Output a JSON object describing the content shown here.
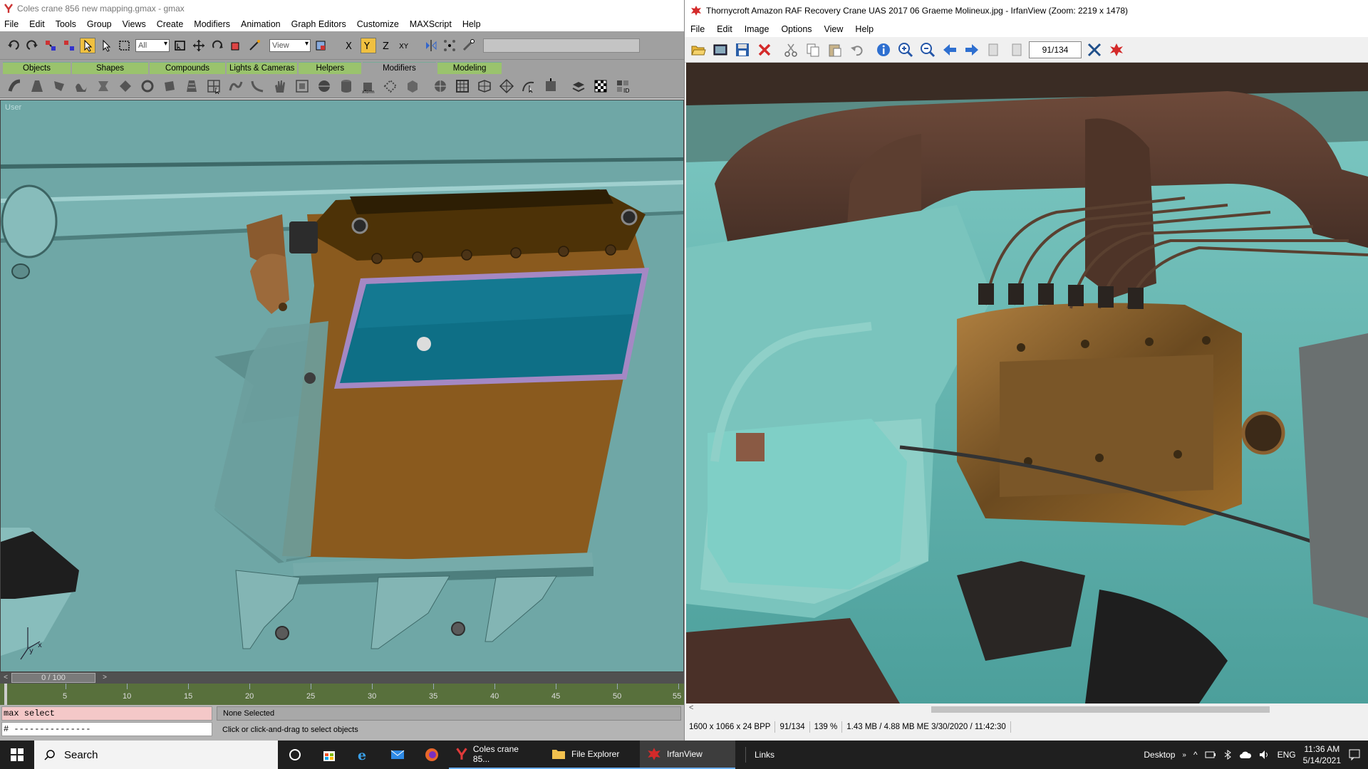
{
  "gmax": {
    "title": "Coles crane 856 new mapping.gmax - gmax",
    "menu": [
      "File",
      "Edit",
      "Tools",
      "Group",
      "Views",
      "Create",
      "Modifiers",
      "Animation",
      "Graph Editors",
      "Customize",
      "MAXScript",
      "Help"
    ],
    "selection_filter": "All",
    "coord_system": "View",
    "tabs": [
      "Objects",
      "Shapes",
      "Compounds",
      "Lights & Cameras",
      "Helpers",
      "Modifiers",
      "Modeling"
    ],
    "viewport_label": "User",
    "time_slider": "0 / 100",
    "track_ticks": [
      "5",
      "10",
      "15",
      "20",
      "25",
      "30",
      "35",
      "40",
      "45",
      "50",
      "55"
    ],
    "listener_line1": "max select",
    "listener_line2": "# ---------------",
    "selection_status": "None Selected",
    "prompt": "Click or click-and-drag to select objects"
  },
  "irfan": {
    "title": "Thornycroft Amazon RAF Recovery Crane UAS 2017 06 Graeme Molineux.jpg - IrfanView (Zoom: 2219 x 1478)",
    "menu": [
      "File",
      "Edit",
      "Image",
      "Options",
      "View",
      "Help"
    ],
    "page": "91/134",
    "status": {
      "dims": "1600 x 1066 x 24 BPP",
      "index": "91/134",
      "zoom": "139 %",
      "size": "1.43 MB / 4.88 MB ME 3/30/2020 / 11:42:30"
    }
  },
  "taskbar": {
    "search": "Search",
    "tasks": [
      "Coles crane 85...",
      "File Explorer",
      "IrfanView"
    ],
    "links": "Links",
    "desktop": "Desktop",
    "lang": "ENG",
    "time": "11:36 AM",
    "date": "5/14/2021"
  },
  "colors": {
    "viewport_bg": "#6fa7a6",
    "engine_brown": "#8a5a1e",
    "tab_green": "#9ac36d",
    "track_green": "#58703c",
    "irfan_red": "#d42a2a"
  }
}
